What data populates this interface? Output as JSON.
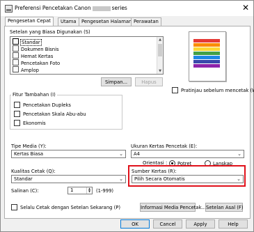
{
  "window": {
    "title_prefix": "Preferensi Pencetakan Canon",
    "title_suffix": "series",
    "close_glyph": "✕"
  },
  "tabs": [
    "Pengesetan Cepat",
    "Utama",
    "Pengesetan Halaman",
    "Perawatan"
  ],
  "common_settings": {
    "label": "Setelan yang Biasa Digunakan (S)",
    "items": [
      "Standar",
      "Dokumen Bisnis",
      "Hemat Kertas",
      "Pencetakan Foto",
      "Amplop"
    ],
    "selected_index": 0,
    "save_button": "Simpan...",
    "delete_button": "Hapus"
  },
  "preview": {
    "checkbox_label": "Pratinjau sebelum mencetak (W)",
    "checked": false
  },
  "additional_features": {
    "label": "Fitur Tambahan (I)",
    "items": [
      {
        "label": "Pencetakan Dupleks",
        "checked": false
      },
      {
        "label": "Pencetakan Skala Abu-abu",
        "checked": false
      },
      {
        "label": "Ekonomis",
        "checked": false
      }
    ]
  },
  "media_type": {
    "label": "Tipe Media (Y):",
    "value": "Kertas Biasa"
  },
  "paper_size": {
    "label": "Ukuran Kertas Pencetak (E):",
    "value": "A4"
  },
  "orientation": {
    "label": "Orientasi :",
    "portrait": "Potret",
    "landscape": "Lanskap",
    "selected": "portrait"
  },
  "print_quality": {
    "label": "Kualitas Cetak (Q):",
    "value": "Standar"
  },
  "paper_source": {
    "label": "Sumber Kertas (R):",
    "value": "Pilih Secara Otomatis"
  },
  "copies": {
    "label": "Salinan (C):",
    "value": "1",
    "range": "(1-999)"
  },
  "always_print": {
    "label": "Selalu Cetak dengan Setelan Sekarang (P)",
    "checked": false
  },
  "buttons": {
    "media_info": "Informasi Media Pencetak...",
    "defaults": "Setelan Asal (F)",
    "ok": "OK",
    "cancel": "Cancel",
    "apply": "Apply",
    "help": "Help"
  },
  "colors": {
    "highlight": "#e0101a",
    "focus": "#0078d7"
  }
}
